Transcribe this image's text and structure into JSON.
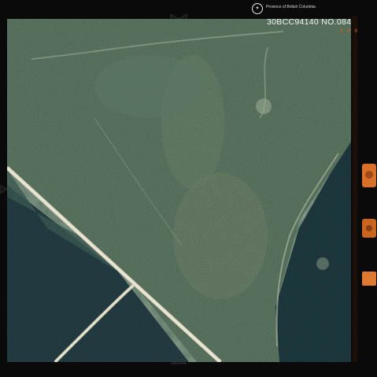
{
  "photo": {
    "frame_id": "30BCC94140 NO.084",
    "agency": "Province of British Columbia",
    "edge_code": "0 0 0"
  },
  "colors": {
    "film_border": "#0a0a0a",
    "forest_light": "#5c7a64",
    "forest_dark": "#1f3a40",
    "clearing": "#8a9a7a",
    "road": "#d8d4bc",
    "film_marker": "#d9702a"
  }
}
